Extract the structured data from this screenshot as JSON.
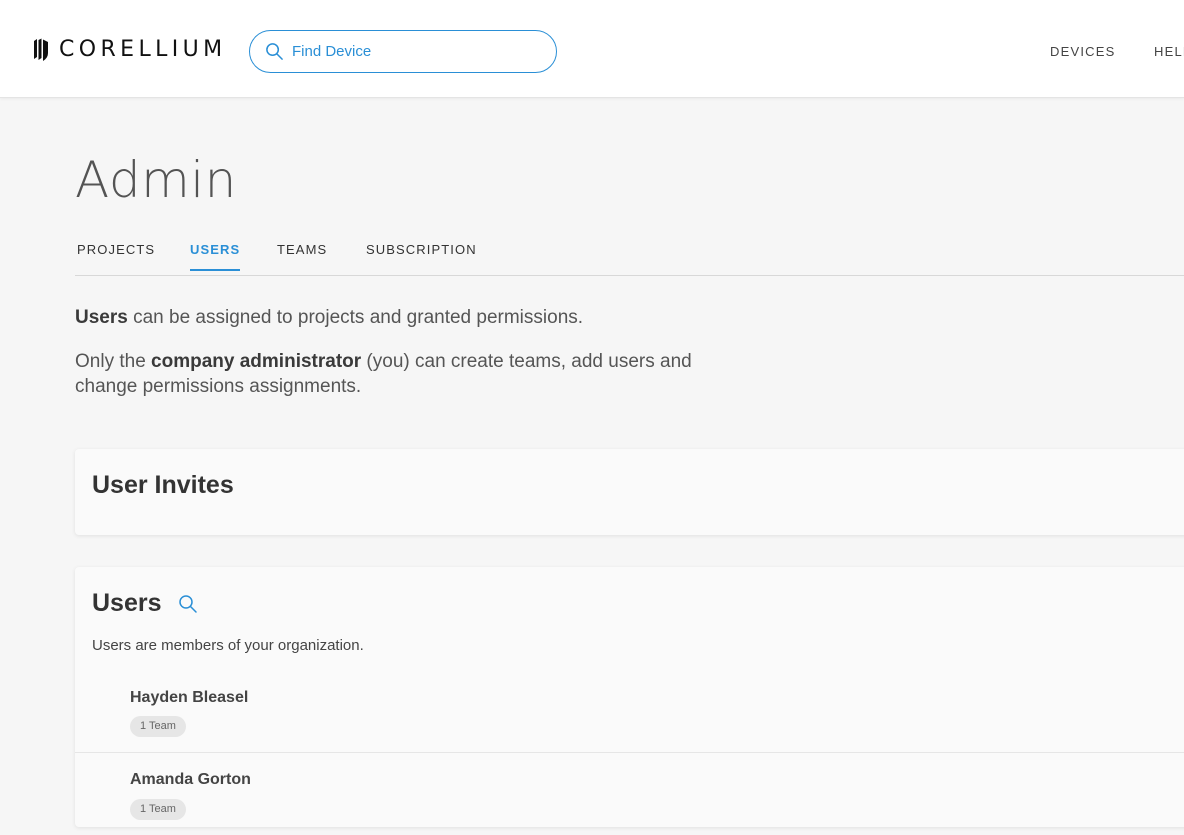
{
  "header": {
    "logo_text": "CORELLIUM",
    "search_placeholder": "Find Device",
    "nav": {
      "devices": "DEVICES",
      "help": "HELP"
    }
  },
  "page": {
    "title": "Admin",
    "tabs": [
      {
        "label": "PROJECTS",
        "active": false
      },
      {
        "label": "USERS",
        "active": true
      },
      {
        "label": "TEAMS",
        "active": false
      },
      {
        "label": "SUBSCRIPTION",
        "active": false
      }
    ]
  },
  "description": {
    "line1_bold": "Users",
    "line1_rest": " can be assigned to projects and granted permissions.",
    "line2_pre": "Only the ",
    "line2_bold": "company administrator",
    "line2_rest": " (you) can create teams, add users and change permissions assignments."
  },
  "invites": {
    "title": "User Invites"
  },
  "users": {
    "title": "Users",
    "subtitle": "Users are members of your organization.",
    "list": [
      {
        "name": "Hayden Bleasel",
        "teams": "1 Team"
      },
      {
        "name": "Amanda Gorton",
        "teams": "1 Team"
      }
    ]
  },
  "colors": {
    "accent": "#2a8fd6",
    "background": "#f6f6f6",
    "card": "#fafafa"
  },
  "icons": [
    "corellium-logo-icon",
    "search-icon",
    "users-search-icon"
  ]
}
